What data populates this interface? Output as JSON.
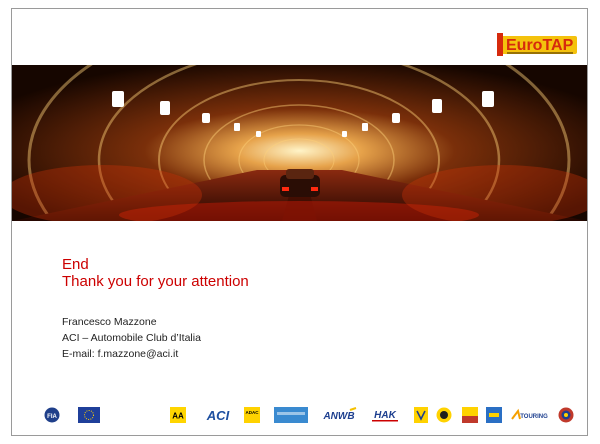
{
  "brand": {
    "logo_text": "EuroTAP",
    "accent_color": "#cc0000",
    "logo_colors": [
      "#f4c20d",
      "#d62a0d"
    ]
  },
  "slide": {
    "title_line1": "End",
    "title_line2": "Thank you for your attention",
    "presenter_name": "Francesco Mazzone",
    "organization": "ACI – Automobile Club d’Italia",
    "email": "E-mail: f.mazzone@aci.it"
  },
  "footer": {
    "badges": [
      "fia-logo-icon",
      "eu-flag-icon",
      "aa-logo-icon",
      "aci-logo-icon",
      "adac-logo-icon",
      "anwb-logo-icon",
      "hak-logo-icon",
      "tcs-logo-icon",
      "racc-logo-icon",
      "touring-logo-icon"
    ]
  }
}
